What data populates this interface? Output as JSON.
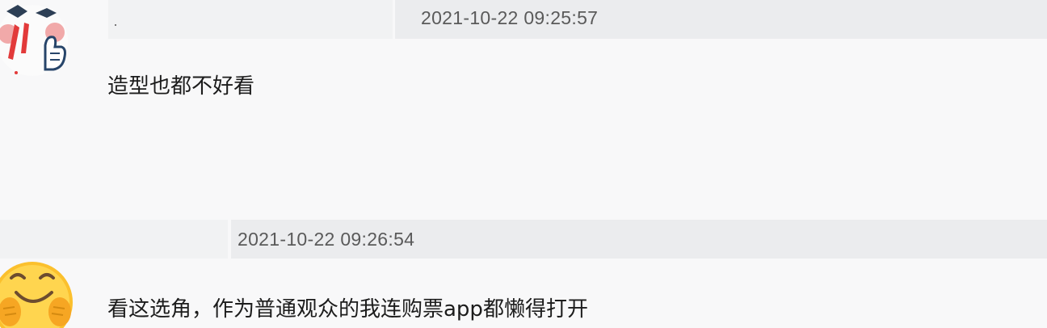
{
  "comments": [
    {
      "timestamp": "2021-10-22 09:25:57",
      "text": "造型也都不好看",
      "avatar_icon": "cartoon-thumbs-up-avatar"
    },
    {
      "timestamp": "2021-10-22 09:26:54",
      "text": "看这选角，作为普通观众的我连购票app都懒得打开",
      "avatar_icon": "smiling-emoji-avatar"
    }
  ],
  "colors": {
    "background": "#f8f8f9",
    "meta_bar": "#ebecee",
    "timestamp_text": "#5a5a5a",
    "comment_text": "#1c1c1c"
  }
}
